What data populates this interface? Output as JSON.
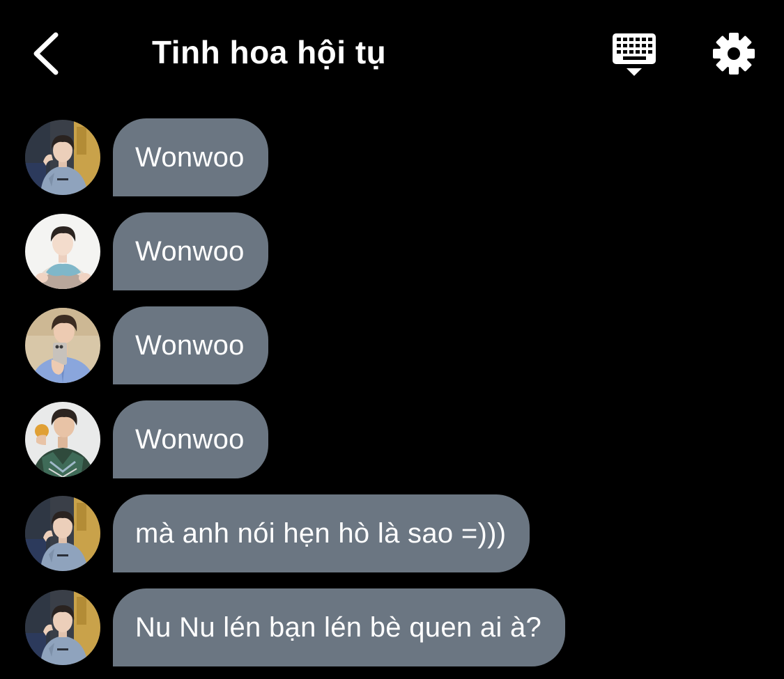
{
  "header": {
    "title": "Tinh hoa hội tụ",
    "back_icon": "chevron-left-icon",
    "keyboard_icon": "keyboard-hide-icon",
    "settings_icon": "gear-icon"
  },
  "colors": {
    "background": "#000000",
    "bubble": "#6b7682",
    "text": "#ffffff"
  },
  "messages": [
    {
      "avatar": "avatar-boy-blue-hoodie",
      "text": "Wonwoo"
    },
    {
      "avatar": "avatar-boy-scarf",
      "text": "Wonwoo"
    },
    {
      "avatar": "avatar-boy-phone-selfie",
      "text": "Wonwoo"
    },
    {
      "avatar": "avatar-boy-green-jacket",
      "text": "Wonwoo"
    },
    {
      "avatar": "avatar-boy-blue-hoodie",
      "text": "mà anh nói hẹn hò là sao =)))"
    },
    {
      "avatar": "avatar-boy-blue-hoodie",
      "text": "Nu Nu lén bạn lén bè quen ai à?"
    }
  ]
}
